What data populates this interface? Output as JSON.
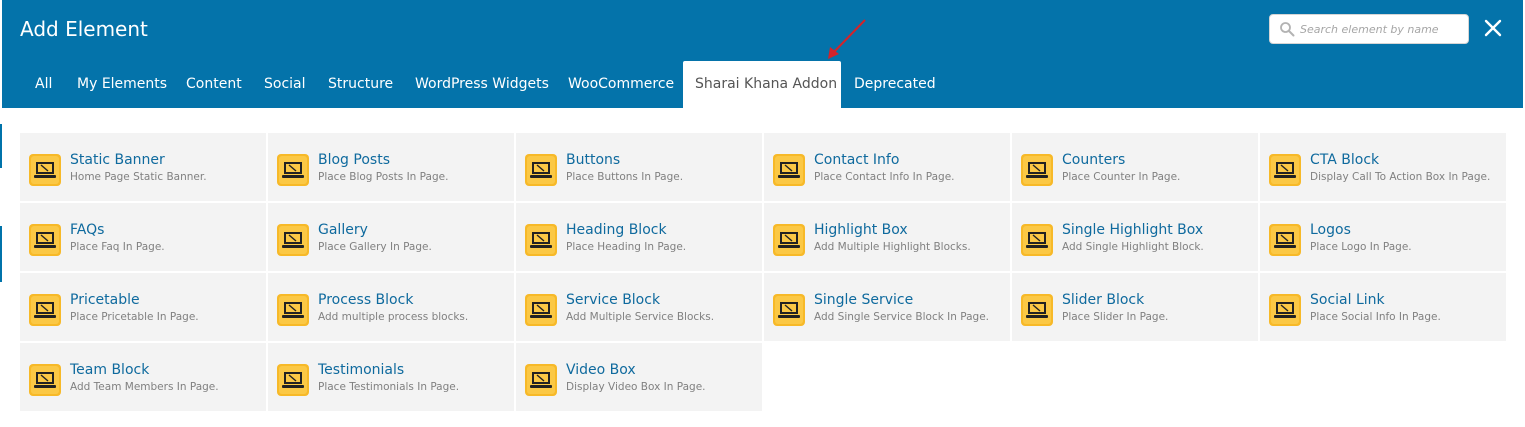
{
  "modal": {
    "title": "Add Element",
    "search_placeholder": "Search element by name",
    "accent_color": "#0473aa"
  },
  "tabs": [
    {
      "label": "All"
    },
    {
      "label": "My Elements"
    },
    {
      "label": "Content"
    },
    {
      "label": "Social"
    },
    {
      "label": "Structure"
    },
    {
      "label": "WordPress Widgets"
    },
    {
      "label": "WooCommerce"
    },
    {
      "label": "Sharai Khana Addon",
      "active": true
    },
    {
      "label": "Deprecated"
    }
  ],
  "elements": [
    {
      "title": "Static Banner",
      "desc": "Home Page Static Banner."
    },
    {
      "title": "Blog Posts",
      "desc": "Place Blog Posts In Page."
    },
    {
      "title": "Buttons",
      "desc": "Place Buttons In Page."
    },
    {
      "title": "Contact Info",
      "desc": "Place Contact Info In Page."
    },
    {
      "title": "Counters",
      "desc": "Place Counter In Page."
    },
    {
      "title": "CTA Block",
      "desc": "Display Call To Action Box In Page."
    },
    {
      "title": "FAQs",
      "desc": "Place Faq In Page."
    },
    {
      "title": "Gallery",
      "desc": "Place Gallery In Page."
    },
    {
      "title": "Heading Block",
      "desc": "Place Heading In Page."
    },
    {
      "title": "Highlight Box",
      "desc": "Add Multiple Highlight Blocks."
    },
    {
      "title": "Single Highlight Box",
      "desc": "Add Single Highlight Block."
    },
    {
      "title": "Logos",
      "desc": "Place Logo In Page."
    },
    {
      "title": "Pricetable",
      "desc": "Place Pricetable In Page."
    },
    {
      "title": "Process Block",
      "desc": "Add multiple process blocks."
    },
    {
      "title": "Service Block",
      "desc": "Add Multiple Service Blocks."
    },
    {
      "title": "Single Service",
      "desc": "Add Single Service Block In Page."
    },
    {
      "title": "Slider Block",
      "desc": "Place Slider In Page."
    },
    {
      "title": "Social Link",
      "desc": "Place Social Info In Page."
    },
    {
      "title": "Team Block",
      "desc": "Add Team Members In Page."
    },
    {
      "title": "Testimonials",
      "desc": "Place Testimonials In Page."
    },
    {
      "title": "Video Box",
      "desc": "Display Video Box In Page."
    }
  ],
  "icons": {
    "element_icon": "monitor-tools-icon",
    "search": "search-icon",
    "close": "close-icon",
    "annotation": "red-arrow-icon"
  }
}
